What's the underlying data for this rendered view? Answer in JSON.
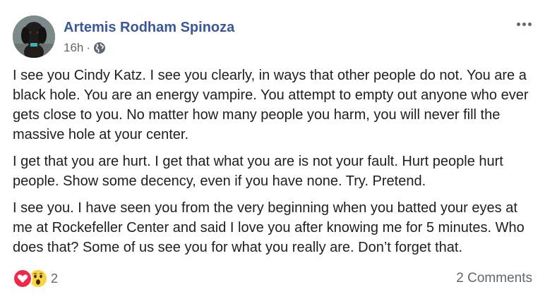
{
  "post": {
    "author": "Artemis Rodham Spinoza",
    "time": "16h",
    "separator": "·",
    "privacy_icon": "globe-icon",
    "more_icon": "more-options-icon",
    "paragraphs": [
      "I see you Cindy Katz. I see you clearly, in ways that other people do not. You are a black hole. You are an energy vampire. You attempt to empty out anyone who ever gets close to you. No matter how many people you harm, you will never fill the massive hole at your center.",
      "I get that you are hurt. I get that what you are is not your fault. Hurt people hurt people. Show some decency, even if you have none. Try. Pretend.",
      "I see you. I have seen you from the very beginning when you batted your eyes at me at Rockefeller Center and said I love you after knowing me for 5 minutes. Who does that? Some of us see you for what you really are. Don’t forget that."
    ]
  },
  "footer": {
    "reactions": [
      "love-icon",
      "wow-icon"
    ],
    "reaction_count": "2",
    "comments_label": "2 Comments"
  },
  "colors": {
    "author": "#385898",
    "secondary_text": "#606770",
    "love": "#f0284a",
    "wow": "#fcd440"
  }
}
